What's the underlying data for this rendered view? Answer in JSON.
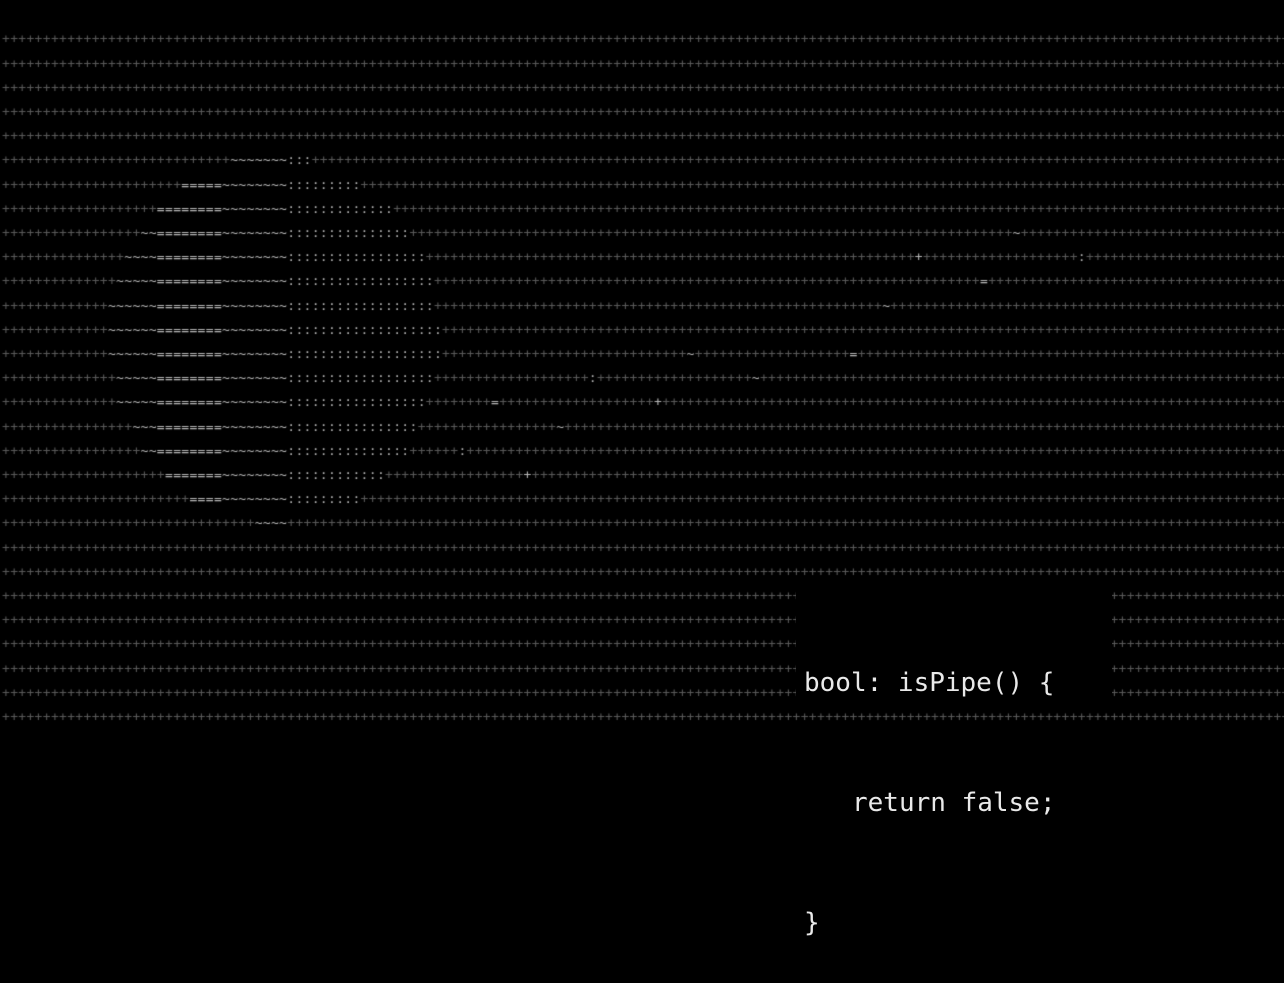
{
  "code_snippet": {
    "line1": "bool: isPipe() {",
    "line2": "return false;",
    "line3": "}"
  },
  "art": {
    "subject": "pipe",
    "background_char": "+",
    "shade_chars": [
      "~",
      "=",
      ":",
      "."
    ],
    "colors": {
      "background": "#000000",
      "grid_glyph": "#5a5a5a",
      "art_glyph": "#b8b8b8",
      "code_text": "#e9e9e9"
    }
  }
}
